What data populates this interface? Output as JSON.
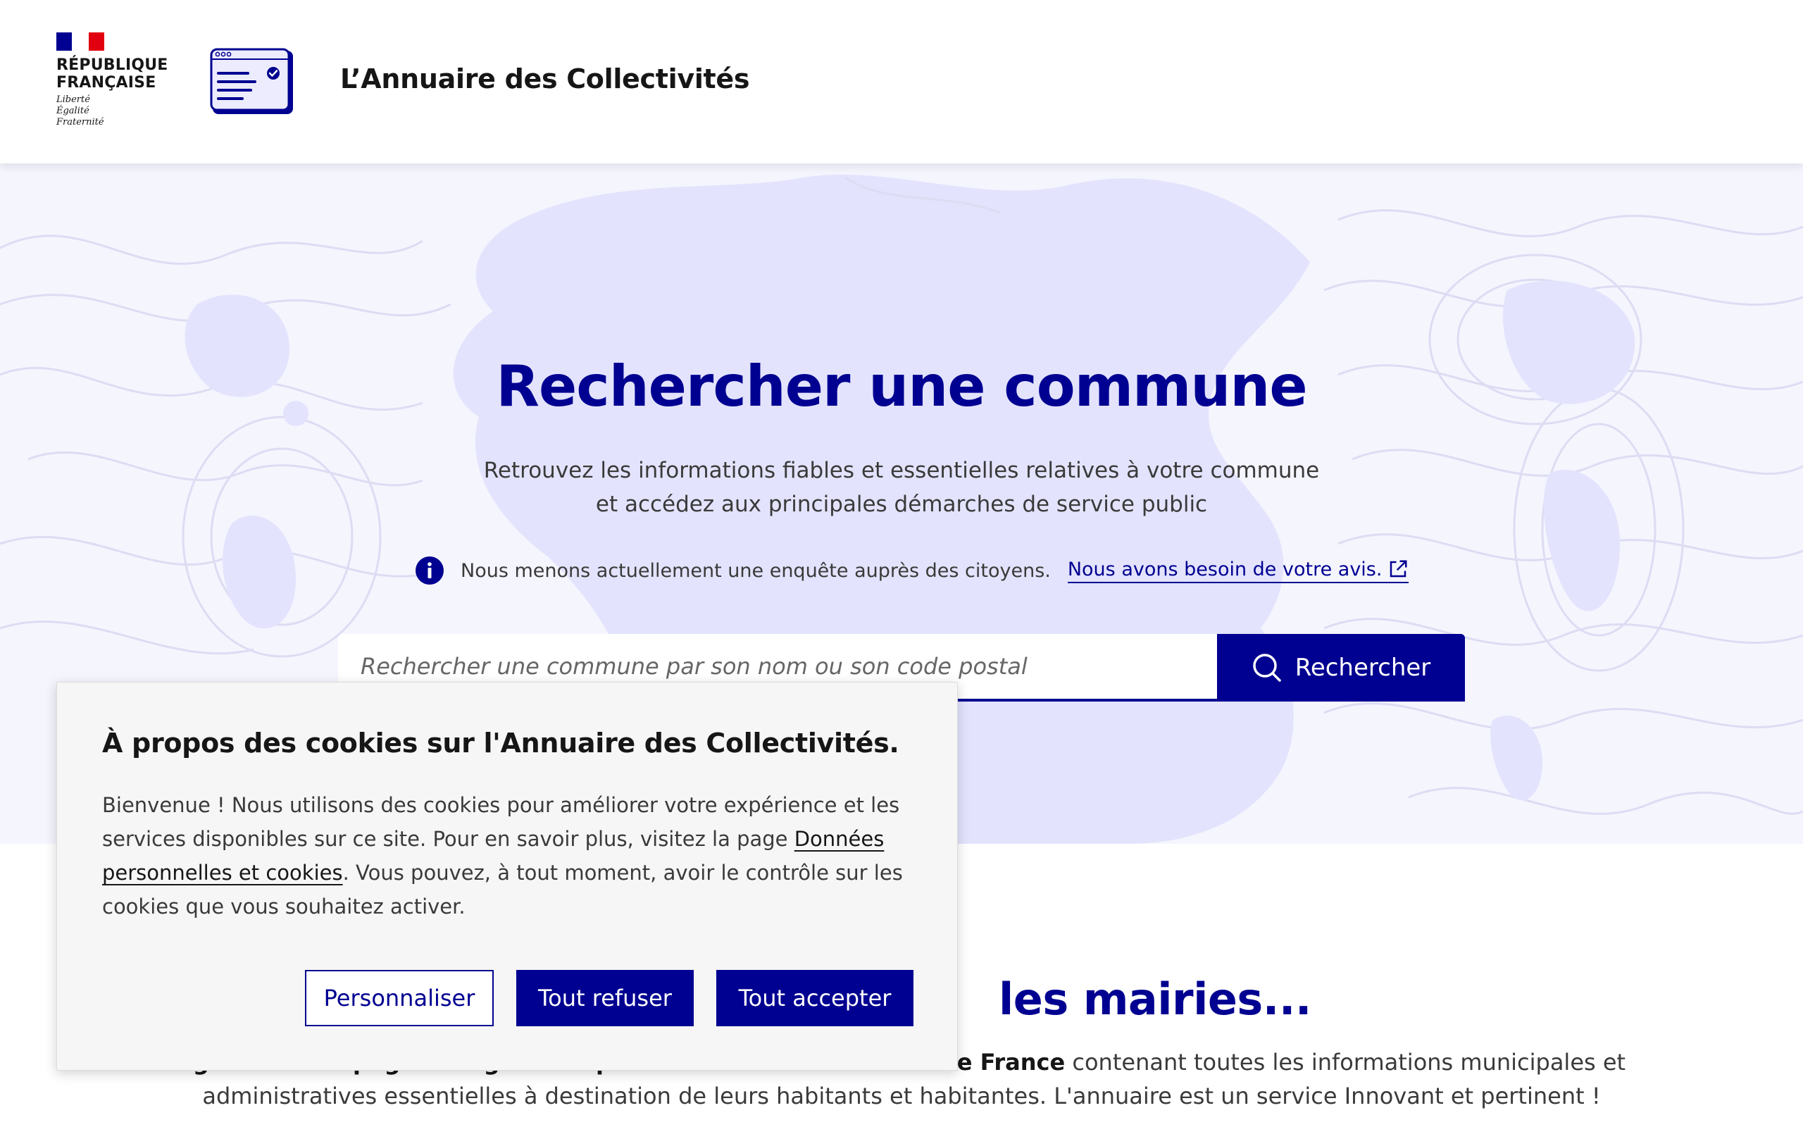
{
  "header": {
    "republic_lines": [
      "RÉPUBLIQUE",
      "FRANÇAISE"
    ],
    "motto_lines": [
      "Liberté",
      "Égalité",
      "Fraternité"
    ],
    "site_title": "L’Annuaire des Collectivités"
  },
  "hero": {
    "title": "Rechercher une commune",
    "description_lines": [
      "Retrouvez les informations fiables et essentielles relatives à votre commune",
      "et accédez aux principales démarches de service public"
    ],
    "notice": {
      "icon": "info-icon",
      "text": "Nous menons actuellement une enquête auprès des citoyens.",
      "link_text": "Nous avons besoin de votre avis.",
      "link_icon": "external-link-icon"
    },
    "search": {
      "placeholder": "Rechercher une commune par son nom ou son code postal",
      "value": "",
      "button_label": "Rechercher",
      "button_icon": "search-icon"
    }
  },
  "section": {
    "title_visible": "les mairies...",
    "text_line1_visible_bold": "ligrade a une page web generee pour toutes les communes de France",
    "text_line1_rest": " contenant toutes les informations municipales et",
    "text_line2": "administratives essentielles à destination de leurs habitants et habitantes. L'annuaire est un service Innovant et pertinent !"
  },
  "cookie_banner": {
    "title": "À propos des cookies sur l'Annuaire des Collectivités.",
    "text_before_link": "Bienvenue ! Nous utilisons des cookies pour améliorer votre expérience et les services disponibles sur ce site. Pour en savoir plus, visitez la page ",
    "link_text": "Données personnelles et cookies",
    "text_after_link": ". Vous pouvez, à tout moment, avoir le contrôle sur les cookies que vous souhaitez activer.",
    "buttons": {
      "customize": "Personnaliser",
      "refuse": "Tout refuser",
      "accept": "Tout accepter"
    }
  },
  "colors": {
    "primary": "#000091",
    "hero_background": "#f5f5fe",
    "hero_shape": "#e3e3fd",
    "topo_lines": "#dcdcf3",
    "flag_red": "#e1000f",
    "cookie_background": "#f6f6f6"
  }
}
